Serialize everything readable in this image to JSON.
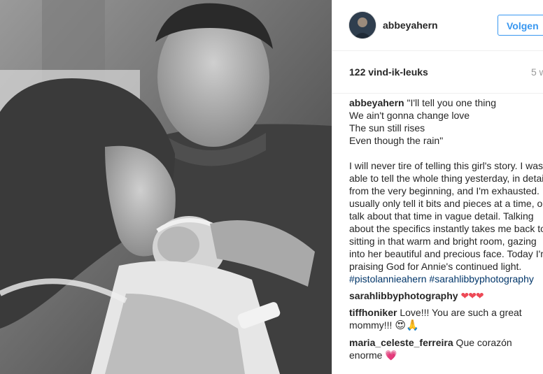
{
  "post": {
    "username": "abbeyahern",
    "follow_label": "Volgen",
    "likes": "122 vind-ik-leuks",
    "time": "5 w",
    "caption_user": "abbeyahern",
    "caption_text": " \"I'll tell you one thing\nWe ain't gonna change love\nThe sun still rises\nEven though the rain\"\n\nI will never tire of telling this girl's story. I was able to tell the whole thing yesterday, in detail, from the very beginning, and I'm exhausted. I usually only tell it bits and pieces at a time, or talk about that time in vague detail. Talking about the specifics instantly takes me back to sitting in that warm and bright room, gazing into her beautiful and precious face. Today I'm praising God for Annie's continued light.\n",
    "hashtags": "#pistolannieahern #sarahlibbyphotography"
  },
  "comments": [
    {
      "user": "sarahlibbyphotography",
      "text": " ",
      "emoji": "❤❤❤"
    },
    {
      "user": "tiffhoniker",
      "text": " Love!!! You are such a great mommy!!! ",
      "emoji": "😍🙏"
    },
    {
      "user": "maria_celeste_ferreira",
      "text": " Que corazón enorme ",
      "emoji": "💗"
    }
  ],
  "colors": {
    "accent": "#3897f0",
    "hashtag": "#003569",
    "heart": "#ed4956"
  },
  "icons": {
    "avatar": "profile-photo",
    "photo": "newborn-hospital-photo"
  }
}
